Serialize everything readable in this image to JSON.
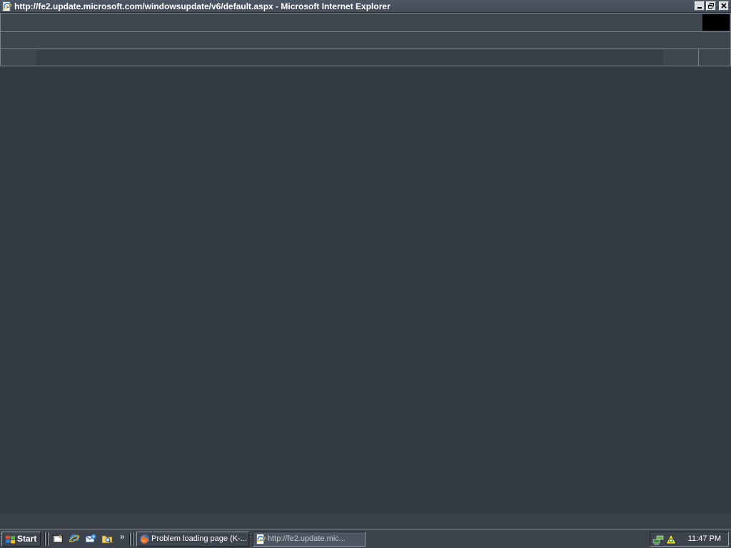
{
  "window": {
    "title": "http://fe2.update.microsoft.com/windowsupdate/v6/default.aspx - Microsoft Internet Explorer",
    "icon": "ie-page-icon",
    "controls": [
      "minimize-icon",
      "restore-icon",
      "close-icon"
    ]
  },
  "browser": {
    "toolbars": [
      "menu-toolbar",
      "buttons-toolbar",
      "address-toolbar"
    ],
    "address_value": "",
    "content_state": "blank"
  },
  "taskbar": {
    "start_label": "Start",
    "quick_launch": [
      {
        "icon": "show-desktop-icon"
      },
      {
        "icon": "internet-explorer-icon"
      },
      {
        "icon": "outlook-express-icon"
      },
      {
        "icon": "windows-explorer-icon"
      }
    ],
    "chevron": "»",
    "tasks": [
      {
        "label": "Problem loading page (K-...",
        "icon": "firefox-icon",
        "active": false
      },
      {
        "label": "http://fe2.update.mic...",
        "icon": "ie-page-icon",
        "active": true
      }
    ],
    "tray": {
      "icons": [
        "network-icon",
        "security-alert-icon"
      ],
      "clock": "11:47 PM"
    }
  },
  "colors": {
    "desktop_bg": "#333940",
    "title_bar": "#4d5663",
    "toolbar": "#3f4650",
    "throbber": "#000000"
  }
}
